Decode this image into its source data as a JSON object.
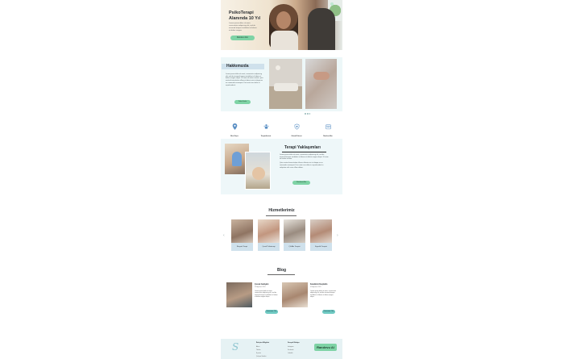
{
  "hero": {
    "title": "PsikoTerapi Alanında 10 Yıl",
    "text": "Lorem ipsum dolor sit amet, consectetur adipiscing elit, sed do eiusmod tempor incididunt ut labore et dolore magna.",
    "button": "Randevu Alın"
  },
  "about": {
    "title": "Hakkımızda",
    "text": "Lorem ipsum dolor sit amet, consectetur adipiscing elit, sed do eiusmod tempor incididunt ut labore et dolore magna aliqua. Ut enim ad minim veniam, quis nostrud exercitation ullamco laboris nisi ut aliquip ex ea commodo consequat. Duis aute irure dolor in reprehenderit.",
    "button": "Daha Fazla"
  },
  "features": [
    {
      "label": "Bize Ulaşın",
      "icon": "location-pin-icon"
    },
    {
      "label": "Terapistlerimiz",
      "icon": "people-icon"
    },
    {
      "label": "Güvenli Hizmet",
      "icon": "shield-heart-icon"
    },
    {
      "label": "Randevu Alın",
      "icon": "calendar-icon"
    }
  ],
  "approaches": {
    "title": "Terapi Yaklaşımları",
    "text1": "Lorem ipsum dolor sit amet, consectetur adipiscing elit, sed do eiusmod tempor incididunt ut labore et dolore magna aliqua. Ut enim ad minim veniam.",
    "text2": "Quis nostrud exercitation ullamco laboris nisi ut aliquip ex ea commodo consequat. Duis aute irure dolor in reprehenderit in voluptate velit esse cillum dolore.",
    "button": "Randevu Alın"
  },
  "services": {
    "title": "Hizmetlerimiz",
    "prev": "‹",
    "next": "›",
    "items": [
      {
        "label": "Bireysel Terapi"
      },
      {
        "label": "Çocuk Psikoterapi"
      },
      {
        "label": "Çift Aile Terapisi"
      },
      {
        "label": "Ergenlik Terapisi"
      }
    ]
  },
  "blog": {
    "title": "Blog",
    "posts": [
      {
        "title": "Çocuk Gelişimi",
        "date": "01 Ağustos 2024",
        "text": "Lorem ipsum dolor sit amet, consectetur adipiscing elit, sed do eiusmod tempor incididunt ut labore et dolore magna aliqua.",
        "button": "Devamını Oku"
      },
      {
        "title": "Kendinizi Keşfedin",
        "date": "01 Ağustos 2024",
        "text": "Lorem ipsum dolor sit amet, consectetur adipiscing elit, sed do eiusmod tempor incididunt ut labore et dolore magna aliqua.",
        "button": "Devamını Oku"
      }
    ]
  },
  "footer": {
    "logo": "S",
    "col1_title": "İletişim Bilgileri",
    "col1_links": [
      "Adres",
      "Telefon",
      "E-posta",
      "Çalışma Saatleri"
    ],
    "col2_title": "Sosyal Medya",
    "col2_links": [
      "Instagram",
      "Facebook",
      "LinkedIn"
    ],
    "button": "Randevu Al"
  }
}
